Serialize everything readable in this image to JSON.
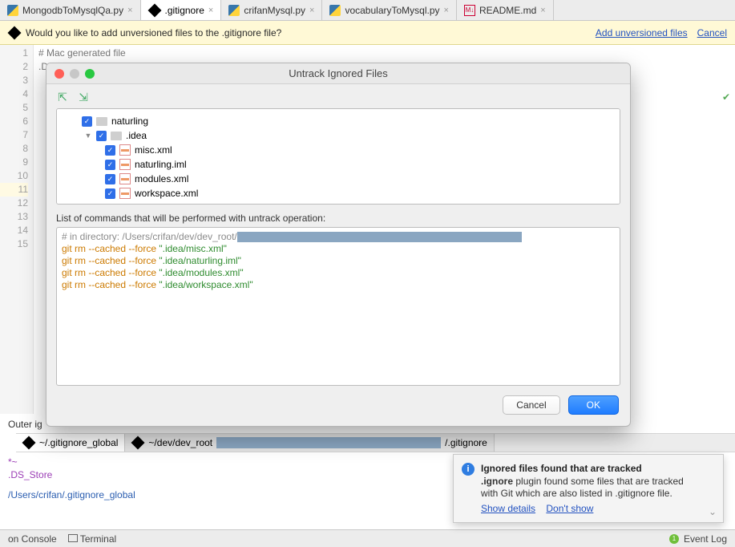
{
  "tabs": [
    {
      "label": "MongodbToMysqlQa.py",
      "kind": "py"
    },
    {
      "label": ".gitignore",
      "kind": "git",
      "active": true
    },
    {
      "label": "crifanMysql.py",
      "kind": "py"
    },
    {
      "label": "vocabularyToMysql.py",
      "kind": "py"
    },
    {
      "label": "README.md",
      "kind": "md"
    }
  ],
  "banner": {
    "message": "Would you like to add unversioned files to the .gitignore file?",
    "link_add": "Add unversioned files",
    "link_cancel": "Cancel"
  },
  "editor": {
    "line1": "# Mac generated file",
    "line2": ".DS_Store",
    "line_numbers": [
      "1",
      "2",
      "3",
      "4",
      "5",
      "6",
      "7",
      "8",
      "9",
      "10",
      "11",
      "12",
      "13",
      "14",
      "15"
    ]
  },
  "modal": {
    "title": "Untrack Ignored Files",
    "tree": [
      {
        "label": "naturling",
        "kind": "folder",
        "level": 1,
        "expand": ""
      },
      {
        "label": ".idea",
        "kind": "folder",
        "level": 2,
        "expand": "▼"
      },
      {
        "label": "misc.xml",
        "kind": "file",
        "level": 3
      },
      {
        "label": "naturling.iml",
        "kind": "file",
        "level": 3
      },
      {
        "label": "modules.xml",
        "kind": "file",
        "level": 3
      },
      {
        "label": "workspace.xml",
        "kind": "file",
        "level": 3
      }
    ],
    "cmd_label": "List of commands that will be performed with untrack operation:",
    "cmds": {
      "c0_pre": "# in directory: /Users/crifan/dev/dev_root/",
      "c1a": "git rm --cached --force ",
      "c1b": "\".idea/misc.xml\"",
      "c2a": "git rm --cached --force ",
      "c2b": "\".idea/naturling.iml\"",
      "c3a": "git rm --cached --force ",
      "c3b": "\".idea/modules.xml\"",
      "c4a": "git rm --cached --force ",
      "c4b": "\".idea/workspace.xml\""
    },
    "btn_cancel": "Cancel",
    "btn_ok": "OK"
  },
  "lower": {
    "title": "Outer ig",
    "tab1": "~/.gitignore_global",
    "tab2_pre": "~/dev/dev_root",
    "tab2_post": "/.gitignore",
    "code_l1": "*~",
    "code_l2": ".DS_Store",
    "path": "/Users/crifan/.gitignore_global"
  },
  "notif": {
    "title": "Ignored files found that are tracked",
    "body_strong": ".ignore",
    "body_rest": " plugin found some files that are tracked with Git which are also listed in .gitignore file.",
    "link_show": "Show details",
    "link_dont": "Don't show"
  },
  "status": {
    "console": "on Console",
    "terminal": "Terminal",
    "eventlog": "Event Log"
  }
}
